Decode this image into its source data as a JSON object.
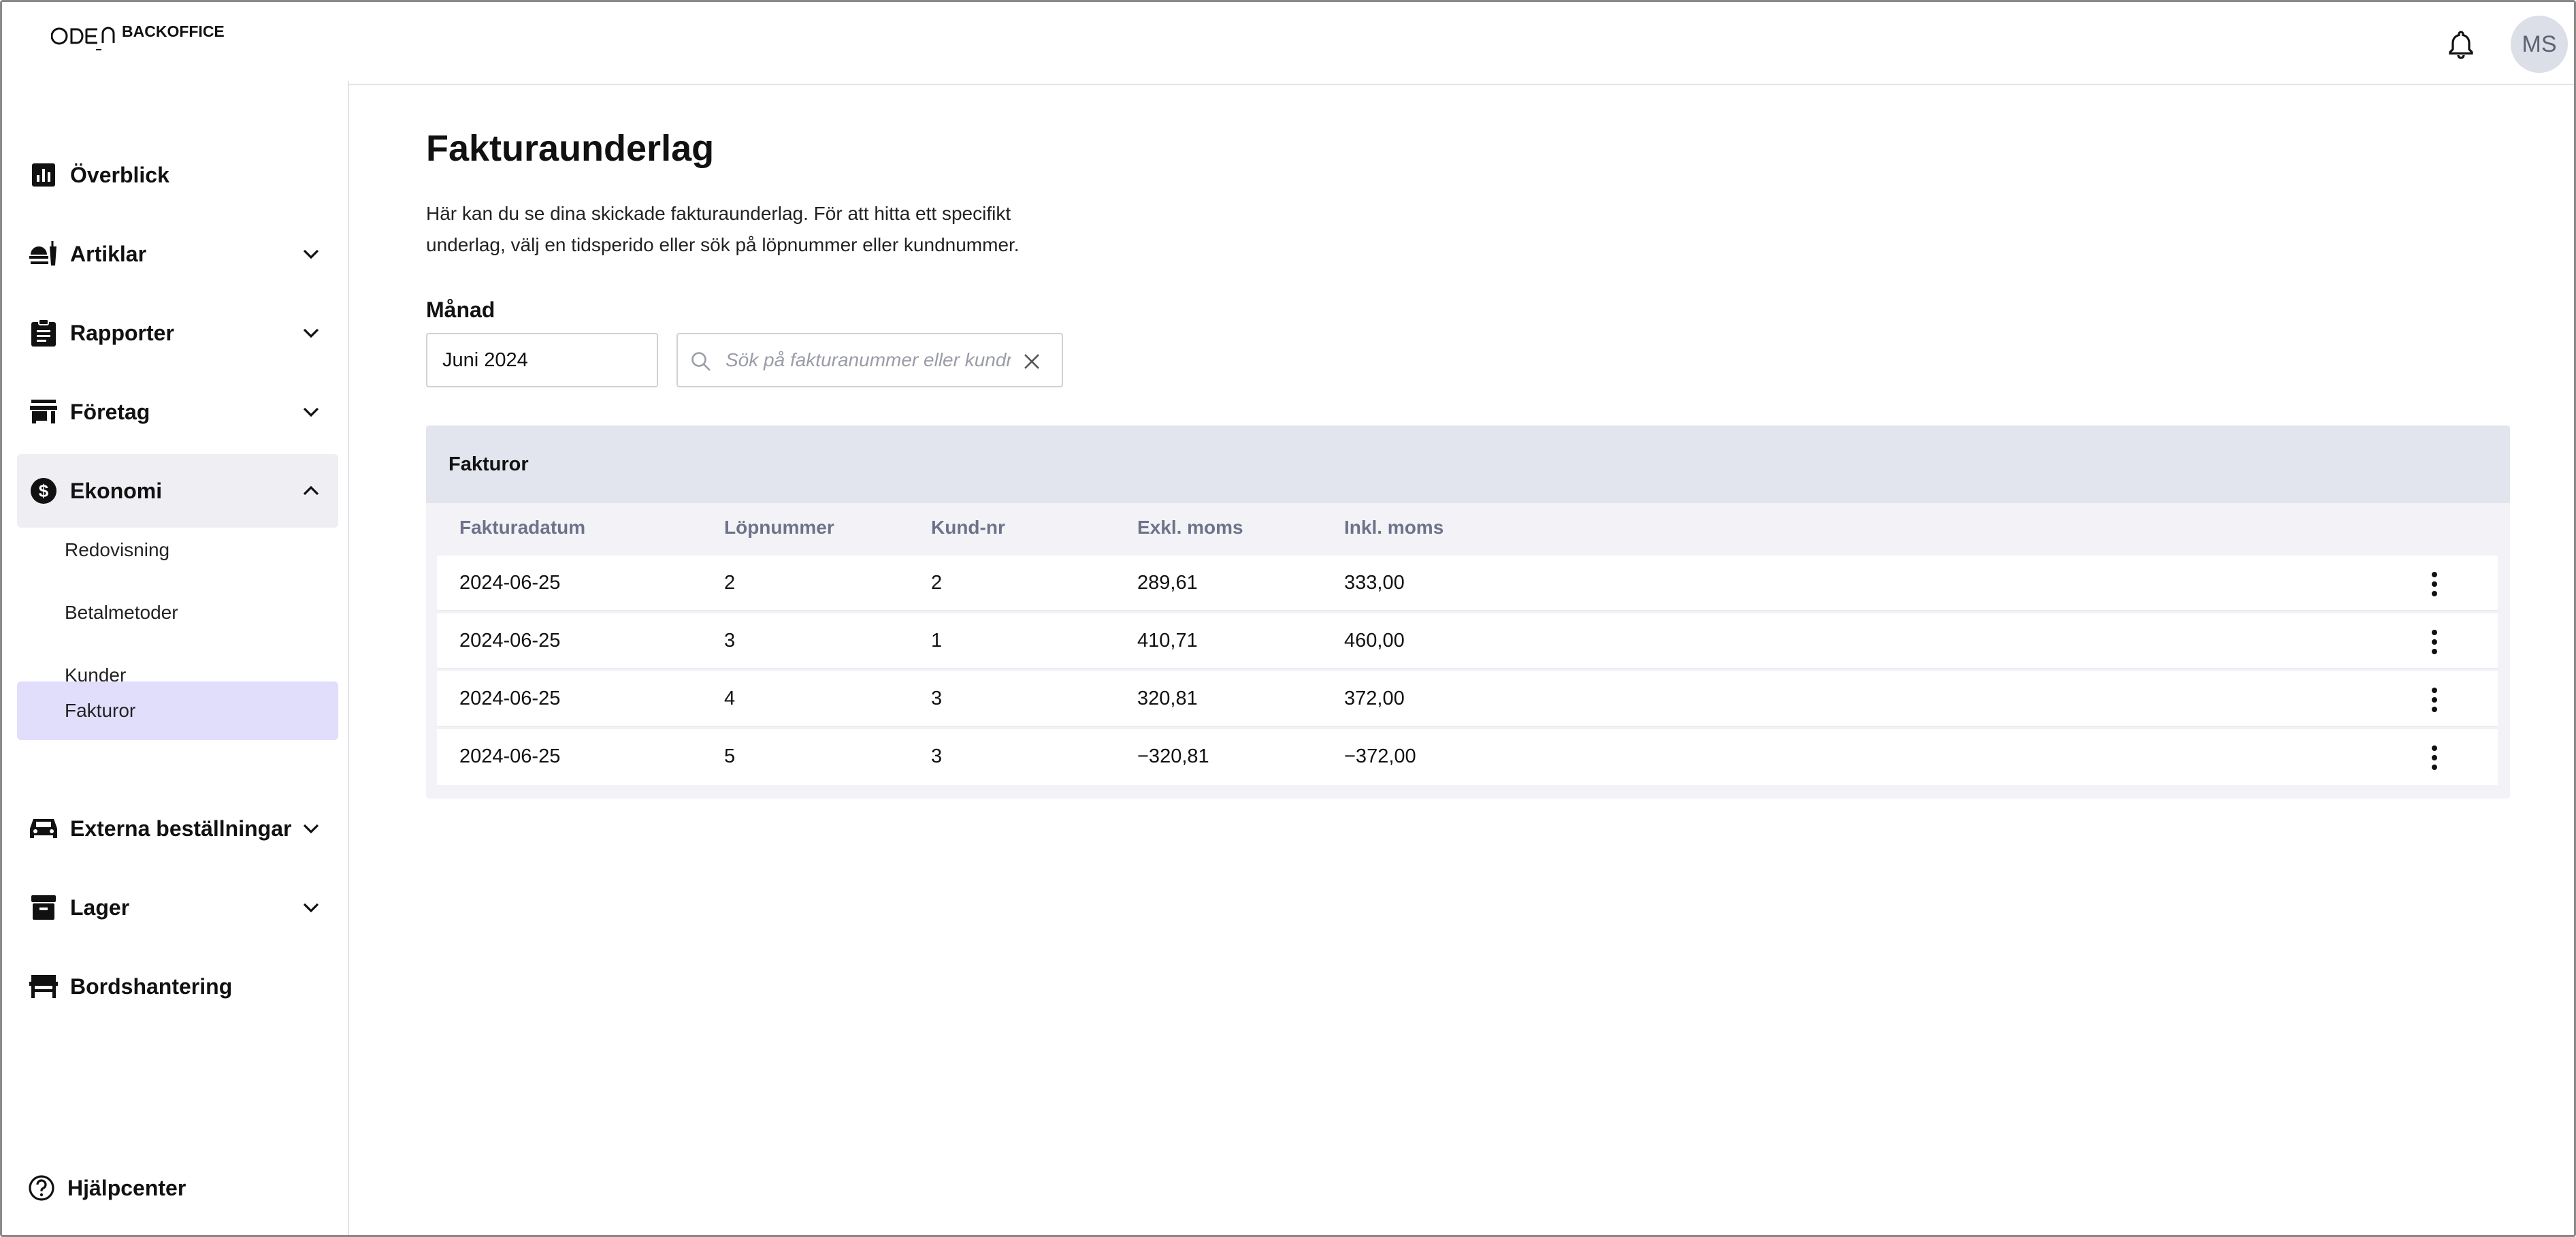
{
  "header": {
    "logo_mark": "ОРЕЛ",
    "logo_text": "BACKOFFICE",
    "avatar_initials": "MS"
  },
  "sidebar": {
    "items": [
      {
        "label": "Överblick",
        "icon": "bar-chart-icon"
      },
      {
        "label": "Artiklar",
        "icon": "food-icon"
      },
      {
        "label": "Rapporter",
        "icon": "clipboard-icon"
      },
      {
        "label": "Företag",
        "icon": "store-icon"
      },
      {
        "label": "Ekonomi",
        "icon": "dollar-circle-icon"
      },
      {
        "label": "Externa beställningar",
        "icon": "car-icon"
      },
      {
        "label": "Lager",
        "icon": "archive-icon"
      },
      {
        "label": "Bordshantering",
        "icon": "table-icon"
      }
    ],
    "sub_items": [
      "Redovisning",
      "Betalmetoder",
      "Kunder",
      "Fakturor"
    ],
    "help": "Hjälpcenter"
  },
  "main": {
    "title": "Fakturaunderlag",
    "description": "Här kan du se dina skickade fakturaunderlag. För att hitta ett specifikt underlag, välj en tidsperido eller sök på löpnummer eller kundnummer.",
    "month_label": "Månad",
    "month_value": "Juni 2024",
    "search_placeholder": "Sök på fakturanummer eller kundnummer"
  },
  "table": {
    "title": "Fakturor",
    "columns": [
      "Fakturadatum",
      "Löpnummer",
      "Kund-nr",
      "Exkl. moms",
      "Inkl. moms"
    ],
    "rows": [
      [
        "2024-06-25",
        "2",
        "2",
        "289,61",
        "333,00"
      ],
      [
        "2024-06-25",
        "3",
        "1",
        "410,71",
        "460,00"
      ],
      [
        "2024-06-25",
        "4",
        "3",
        "320,81",
        "372,00"
      ],
      [
        "2024-06-25",
        "5",
        "3",
        "−320,81",
        "−372,00"
      ]
    ]
  },
  "colors": {
    "accent_active": "#e0defb",
    "section_open": "#eeeef3",
    "table_header": "#e3e5ee"
  }
}
